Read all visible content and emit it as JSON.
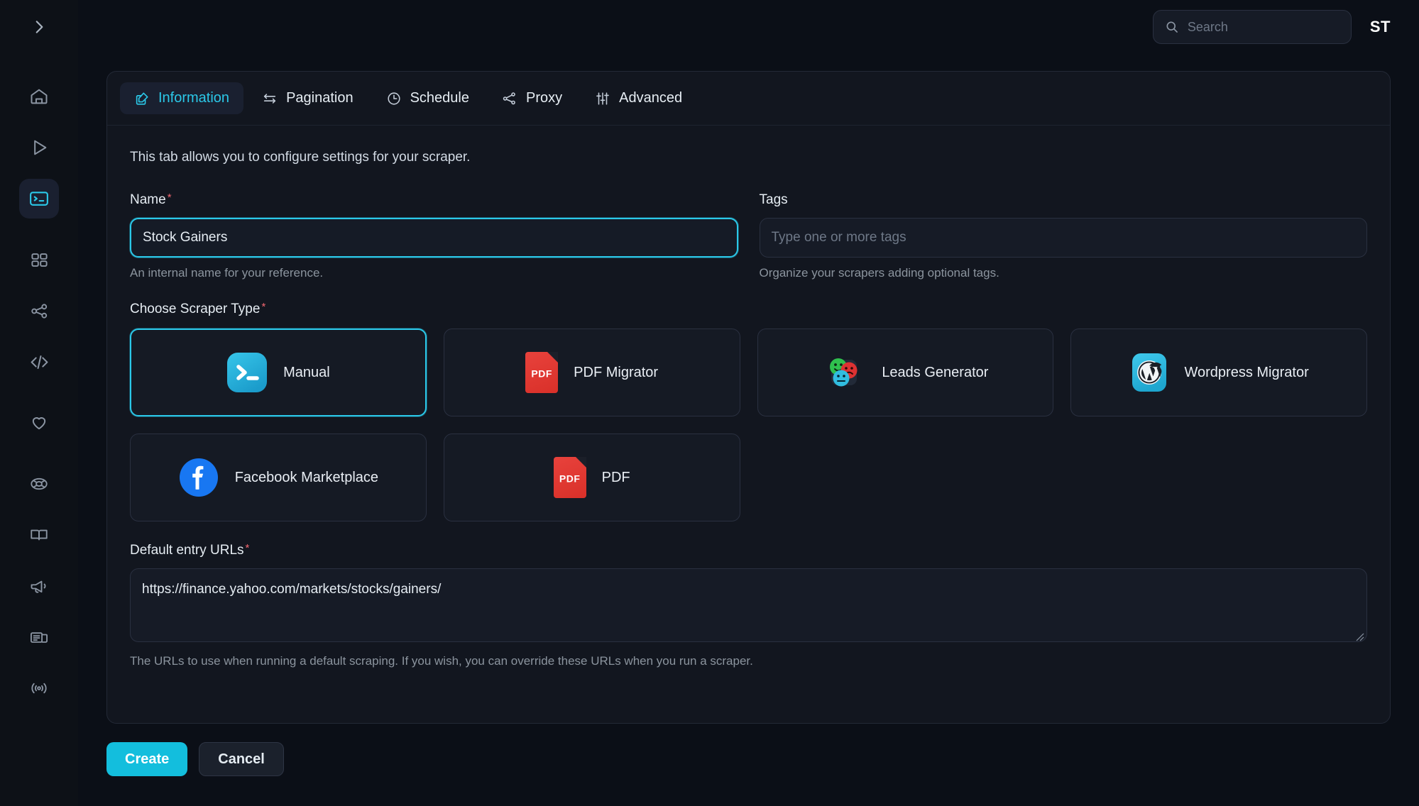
{
  "sidebar": {
    "toggle_icon": "chevron-right-icon",
    "items": [
      {
        "id": "home",
        "icon": "home-icon",
        "active": false
      },
      {
        "id": "runs",
        "icon": "play-icon",
        "active": false
      },
      {
        "id": "scrapers",
        "icon": "terminal-icon",
        "active": true
      },
      {
        "id": "apps",
        "icon": "grid-icon",
        "active": false
      },
      {
        "id": "share",
        "icon": "share-icon",
        "active": false
      },
      {
        "id": "code",
        "icon": "code-icon",
        "active": false
      },
      {
        "id": "favorites",
        "icon": "heart-icon",
        "active": false
      },
      {
        "id": "support",
        "icon": "lifebuoy-icon",
        "active": false
      },
      {
        "id": "docs",
        "icon": "book-icon",
        "active": false
      },
      {
        "id": "announce",
        "icon": "megaphone-icon",
        "active": false
      },
      {
        "id": "news",
        "icon": "newspaper-icon",
        "active": false
      },
      {
        "id": "broadcast",
        "icon": "broadcast-icon",
        "active": false
      }
    ]
  },
  "topbar": {
    "search_placeholder": "Search",
    "search_value": "",
    "search_icon": "search-icon",
    "avatar_initials": "ST"
  },
  "tabs": [
    {
      "id": "information",
      "label": "Information",
      "icon": "edit-square-icon",
      "active": true
    },
    {
      "id": "pagination",
      "label": "Pagination",
      "icon": "arrows-swap-icon",
      "active": false
    },
    {
      "id": "schedule",
      "label": "Schedule",
      "icon": "clock-icon",
      "active": false
    },
    {
      "id": "proxy",
      "label": "Proxy",
      "icon": "share-nodes-icon",
      "active": false
    },
    {
      "id": "advanced",
      "label": "Advanced",
      "icon": "sliders-icon",
      "active": false
    }
  ],
  "form": {
    "intro": "This tab allows you to configure settings for your scraper.",
    "name": {
      "label": "Name",
      "required": true,
      "value": "Stock Gainers",
      "hint": "An internal name for your reference."
    },
    "tags": {
      "label": "Tags",
      "required": false,
      "value": "",
      "placeholder": "Type one or more tags",
      "hint": "Organize your scrapers adding optional tags."
    },
    "scraper_type": {
      "label": "Choose Scraper Type",
      "required": true,
      "options": [
        {
          "id": "manual",
          "label": "Manual",
          "icon": "terminal-app-icon",
          "selected": true
        },
        {
          "id": "pdf-migrator",
          "label": "PDF Migrator",
          "icon": "pdf-file-icon",
          "selected": false
        },
        {
          "id": "leads-generator",
          "label": "Leads Generator",
          "icon": "smileys-icon",
          "selected": false
        },
        {
          "id": "wordpress-migrator",
          "label": "Wordpress Migrator",
          "icon": "wordpress-icon",
          "selected": false
        },
        {
          "id": "facebook-marketplace",
          "label": "Facebook Marketplace",
          "icon": "facebook-icon",
          "selected": false
        },
        {
          "id": "pdf",
          "label": "PDF",
          "icon": "pdf-file-icon",
          "selected": false
        }
      ]
    },
    "entry_urls": {
      "label": "Default entry URLs",
      "required": true,
      "value": "https://finance.yahoo.com/markets/stocks/gainers/",
      "hint": "The URLs to use when running a default scraping. If you wish, you can override these URLs when you run a scraper."
    }
  },
  "footer": {
    "create_label": "Create",
    "cancel_label": "Cancel"
  },
  "colors": {
    "accent": "#2bc8e8",
    "primary_button": "#13bedd",
    "required_star": "#f0666f",
    "page_bg": "#0b0f17",
    "panel_bg": "#12161f",
    "field_bg": "#161b26"
  }
}
